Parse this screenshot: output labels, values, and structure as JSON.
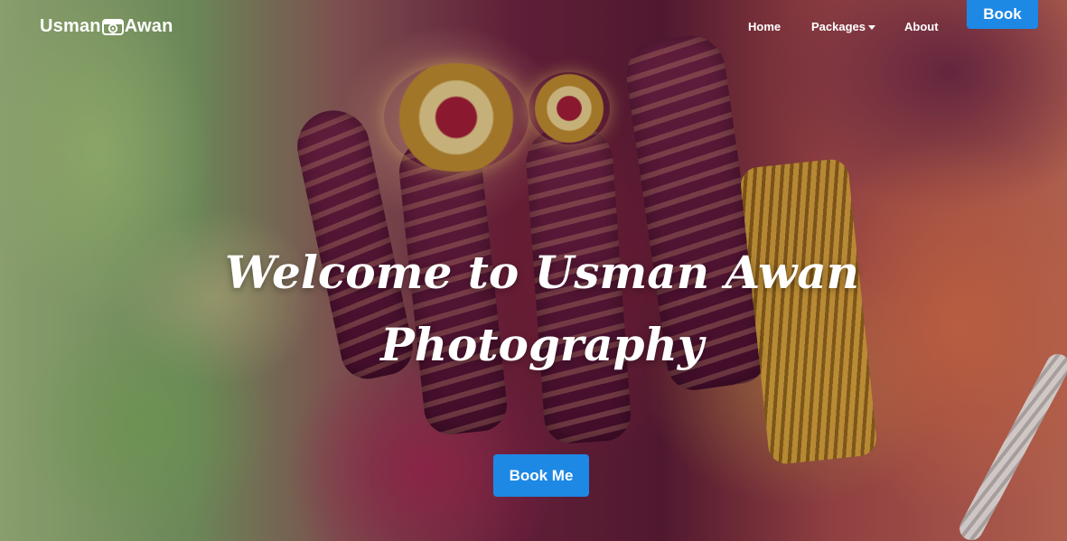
{
  "brand": {
    "left_text": "Usman",
    "icon": "camera-icon",
    "right_text": "Awan"
  },
  "nav": {
    "home": "Home",
    "packages": "Packages",
    "about": "About",
    "book": "Book"
  },
  "hero": {
    "headline": "Welcome to Usman Awan Photography",
    "cta": "Book Me",
    "background": "photo of hands with henna and gold rings"
  },
  "colors": {
    "accent": "#1e88e5",
    "text": "#ffffff"
  }
}
